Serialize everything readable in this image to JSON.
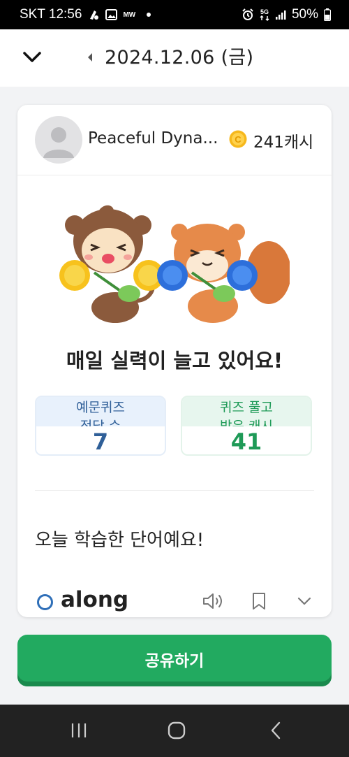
{
  "status_bar": {
    "carrier_time": "SKT 12:56",
    "small_label": "MW",
    "network": "5G",
    "battery": "50%"
  },
  "header": {
    "date": "2024.12.06 (금)"
  },
  "profile": {
    "username": "Peaceful Dyna...",
    "cash": "241캐시"
  },
  "headline": "매일 실력이 늘고 있어요!",
  "stats": [
    {
      "label_line1": "예문퀴즈",
      "label_line2": "정답 수",
      "value": "7"
    },
    {
      "label_line1": "퀴즈 풀고",
      "label_line2": "받은 캐시",
      "value": "41"
    }
  ],
  "words_section": {
    "title": "오늘 학습한 단어예요!",
    "items": [
      {
        "word": "along"
      }
    ]
  },
  "share_button": "공유하기",
  "colors": {
    "accent_green": "#22aa60",
    "stat_blue": "#2f5f98",
    "stat_green": "#1e9a57",
    "coin": "#f6b81c"
  }
}
